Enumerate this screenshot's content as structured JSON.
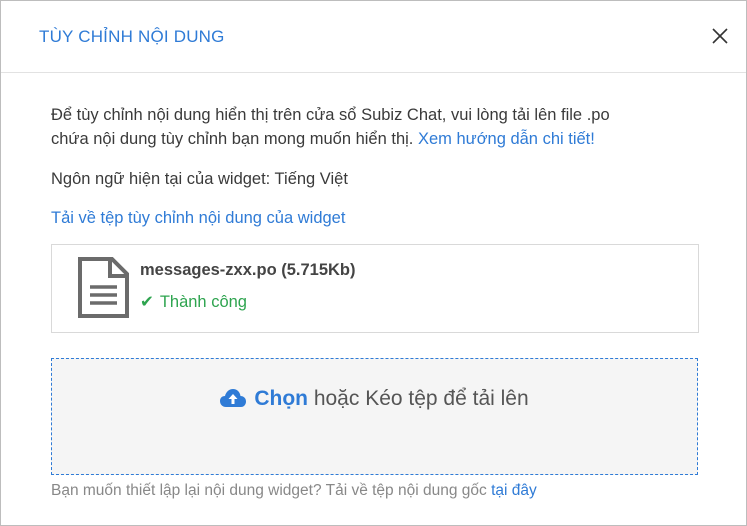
{
  "dialog": {
    "title": "TÙY CHỈNH NỘI DUNG",
    "close_icon": "close-icon"
  },
  "intro": {
    "text_line1": "Để tùy chỉnh nội dung hiển thị trên cửa sổ Subiz Chat, vui lòng tải lên file .po",
    "text_line2": "chứa nội dung tùy chỉnh bạn mong muốn hiển thị.",
    "guide_link": "Xem hướng dẫn chi tiết!"
  },
  "language": {
    "label": "Ngôn ngữ hiện tại của widget: Tiếng Việt"
  },
  "download_link": "Tải về tệp tùy chỉnh nội dung của widget",
  "file": {
    "name": "messages-zxx.po (5.715Kb)",
    "status": "Thành công",
    "icon": "document-icon",
    "status_color": "#2ea44f"
  },
  "dropzone": {
    "choose_label": "Chọn",
    "rest_label": "hoặc Kéo tệp để tải lên",
    "icon": "cloud-upload-icon"
  },
  "footer": {
    "text": "Bạn muốn thiết lập lại nội dung widget? Tải về tệp nội dung gốc",
    "link": "tại đây"
  },
  "colors": {
    "accent": "#2f7bd6",
    "success": "#2ea44f"
  }
}
